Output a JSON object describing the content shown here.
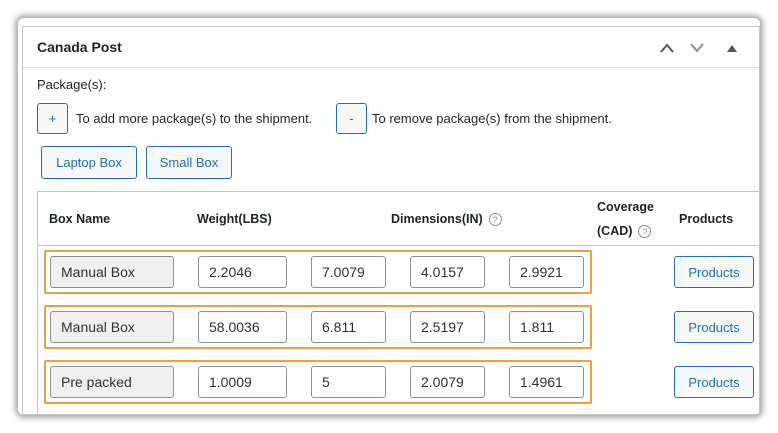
{
  "panel": {
    "title": "Canada Post",
    "controls": {
      "move_up": "▲",
      "move_down": "▼",
      "toggle": "▲"
    }
  },
  "packages": {
    "label": "Package(s):",
    "add_button": "+",
    "add_text": "To add more package(s) to the shipment.",
    "remove_button": "-",
    "remove_text": "To remove package(s) from the shipment."
  },
  "box_buttons": [
    "Laptop Box",
    "Small Box"
  ],
  "table": {
    "headers": {
      "box_name": "Box Name",
      "weight": "Weight(LBS)",
      "dimensions": "Dimensions(IN)",
      "coverage_line1": "Coverage",
      "coverage_line2": "(CAD)",
      "products": "Products"
    },
    "help_glyph": "?",
    "rows": [
      {
        "name": "Manual Box",
        "weight": "2.2046",
        "length": "7.0079",
        "width": "4.0157",
        "height": "2.9921",
        "products": "Products"
      },
      {
        "name": "Manual Box",
        "weight": "58.0036",
        "length": "6.811",
        "width": "2.5197",
        "height": "1.811",
        "products": "Products"
      },
      {
        "name": "Pre packed",
        "weight": "1.0009",
        "length": "5",
        "width": "2.0079",
        "height": "1.4961",
        "products": "Products"
      }
    ]
  },
  "colors": {
    "accent": "#2271b1",
    "highlight": "#e8a33c",
    "border": "#c3c4c7",
    "readonly_bg": "#f0f0f1"
  }
}
